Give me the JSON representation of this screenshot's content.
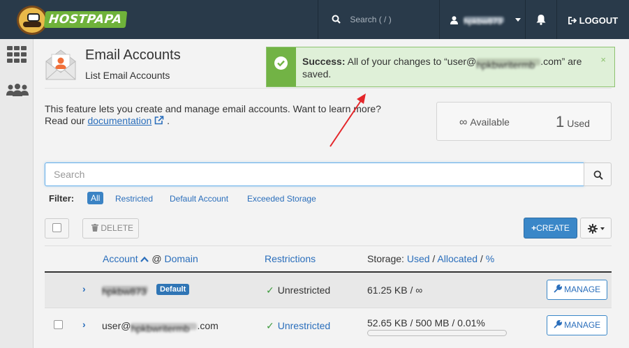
{
  "brand": {
    "name": "HOSTPAPA"
  },
  "topbar": {
    "search_placeholder": "Search ( / )",
    "username": "hpkbw873",
    "logout_label": "LOGOUT"
  },
  "page": {
    "title": "Email Accounts",
    "subtitle": "List Email Accounts"
  },
  "alert": {
    "bold": "Success:",
    "text_before": "All of your changes to “user@",
    "hidden_domain": "hpkbwritermb",
    "text_after": ".com” are saved.",
    "close": "×"
  },
  "description": {
    "line1": "This feature lets you create and manage email accounts. Want to learn more?",
    "read_our": "Read our",
    "doc_link": "documentation",
    "period": "."
  },
  "stats": {
    "available_symbol": "∞",
    "available_label": "Available",
    "used_count": "1",
    "used_label": "Used"
  },
  "search": {
    "placeholder": "Search"
  },
  "filter": {
    "label": "Filter:",
    "options": [
      "All",
      "Restricted",
      "Default Account",
      "Exceeded Storage"
    ]
  },
  "toolbar": {
    "delete_label": "DELETE",
    "create_label": "CREATE"
  },
  "table": {
    "headers": {
      "account": "Account",
      "at": "@",
      "domain": "Domain",
      "restrictions": "Restrictions",
      "storage_prefix": "Storage:",
      "used": "Used",
      "sep1": "/",
      "allocated": "Allocated",
      "sep2": "/",
      "percent": "%"
    },
    "rows": [
      {
        "account": "hpkbw873",
        "badge": "Default",
        "restriction": "Unrestricted",
        "storage": "61.25 KB / ∞",
        "manage": "MANAGE"
      },
      {
        "account_prefix": "user@",
        "hidden_domain": "hpkbwritermb",
        "account_suffix": ".com",
        "restriction": "Unrestricted",
        "storage": "52.65 KB / 500 MB / 0.01%",
        "usage_fraction": 0.0001,
        "manage": "MANAGE"
      }
    ]
  },
  "colors": {
    "topbar": "#293a4a",
    "accent": "#3a87c8",
    "success": "#72b345",
    "link": "#2a6ebb"
  }
}
